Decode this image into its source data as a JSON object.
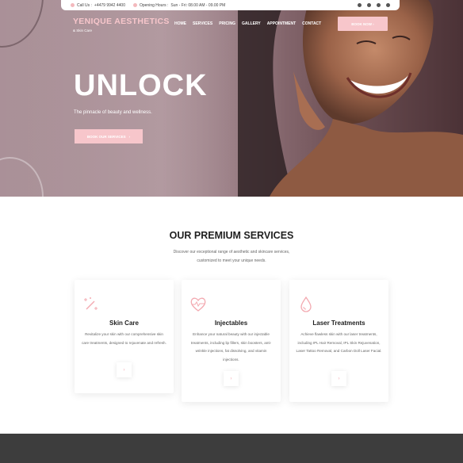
{
  "topbar": {
    "call_label": "Call Us :",
    "phone": "+4479 9942 4400",
    "hours_label": "Opening Hours :",
    "hours": "Sun - Fri: 08.00 AM - 09.00 PM",
    "social_icons": [
      "facebook-icon",
      "twitter-icon",
      "youtube-icon",
      "whatsapp-icon"
    ]
  },
  "brand": {
    "name": "YENIQUE AESTHETICS",
    "tagline": "& Skin Care"
  },
  "nav": {
    "items": [
      "HOME",
      "SERVICES",
      "PRICING",
      "GALLERY",
      "APPOINTMENT",
      "CONTACT"
    ],
    "cta": "BOOK NOW"
  },
  "hero": {
    "title": "UNLOCK",
    "subtitle": "The pinnacle of beauty and wellness.",
    "button": "BOOK OUR SERVICES"
  },
  "services": {
    "title": "OUR PREMIUM SERVICES",
    "description": "Discover our exceptional range of aesthetic and skincare services, customized to meet your unique needs.",
    "cards": [
      {
        "icon": "magic-wand-icon",
        "title": "Skin Care",
        "text": "Revitalize your skin with our comprehensive skin care treatments, designed to rejuvenate and refresh."
      },
      {
        "icon": "heart-pulse-icon",
        "title": "Injectables",
        "text": "Enhance your natural beauty with our injectable treatments, including lip fillers, skin boosters, anti-wrinkle injections, fat dissolving, and vitamin injections."
      },
      {
        "icon": "drop-icon",
        "title": "Laser Treatments",
        "text": "Achieve flawless skin with our laser treatments, including IPL Hair Removal, IPL Skin Rejuvenation, Laser Tattoo Removal, and Carbon Doll Laser Facial."
      }
    ]
  },
  "colors": {
    "accent": "#f7c6cb",
    "footer": "#3d3d3d"
  }
}
